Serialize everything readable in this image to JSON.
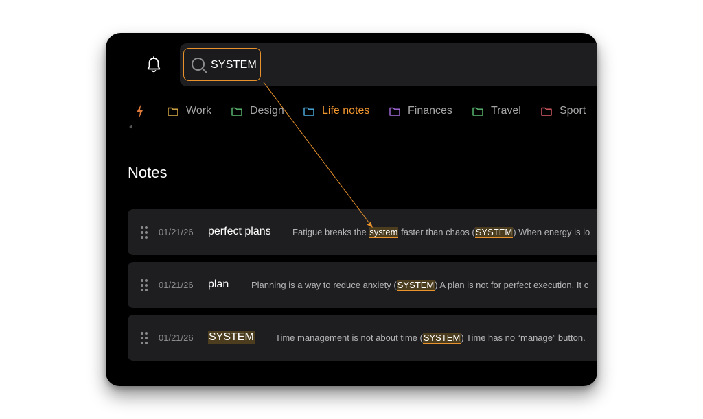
{
  "search": {
    "query": "SYSTEM"
  },
  "categories": [
    {
      "label": "Work",
      "color": "#e0b24a",
      "active": false
    },
    {
      "label": "Design",
      "color": "#5fbf74",
      "active": false
    },
    {
      "label": "Life notes",
      "color": "#4fb4e6",
      "active": true
    },
    {
      "label": "Finances",
      "color": "#a86ee0",
      "active": false
    },
    {
      "label": "Travel",
      "color": "#5fbf74",
      "active": false
    },
    {
      "label": "Sport",
      "color": "#e0606a",
      "active": false
    }
  ],
  "section": {
    "title": "Notes"
  },
  "notes": [
    {
      "date": "01/21/26",
      "title": "perfect plans",
      "preview": {
        "p1": "Fatigue breaks the ",
        "m1": "system",
        "p2": " faster than chaos (",
        "m2": "SYSTEM",
        "p3": ") When energy is lo"
      }
    },
    {
      "date": "01/21/26",
      "title": "plan",
      "preview": {
        "p1": "Planning is a way to reduce anxiety (",
        "m1": "SYSTEM",
        "p2": ") A plan is not for perfect execution. It c"
      }
    },
    {
      "date": "01/21/26",
      "title": "SYSTEM",
      "preview": {
        "p1": "Time management is not about time (",
        "m1": "SYSTEM",
        "p2": ") Time has no “manage” button."
      }
    }
  ],
  "colors": {
    "accent": "#e8922d",
    "background": "#000000",
    "card": "#1e1e20",
    "highlight": "#4b3d1e"
  },
  "icons": [
    "bell-icon",
    "search-icon",
    "bolt-icon",
    "folder-icon",
    "drag-handle-icon"
  ]
}
